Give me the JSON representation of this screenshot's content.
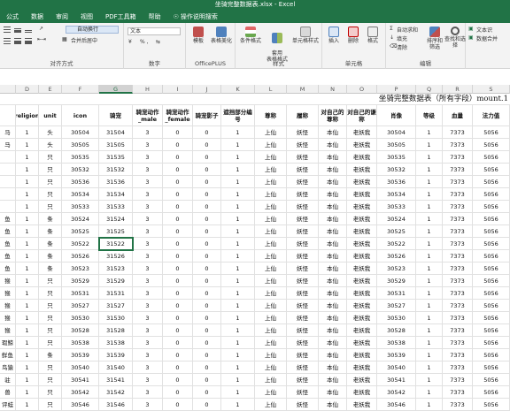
{
  "window_title": "坐骑完整数据表.xlsx  -  Excel",
  "tabs": [
    "公式",
    "数据",
    "审阅",
    "视图",
    "PDF工具箱",
    "帮助",
    "操作说明搜索"
  ],
  "ribbon": {
    "wrap_text": "自动换行",
    "merge_center": "合并后居中",
    "alignment_group": "对齐方式",
    "number_format": "文本",
    "number_group": "数字",
    "number_symbols": "% ,",
    "template": "模板",
    "table_beautify": "表格美化",
    "officeplus_group": "OfficePLUS",
    "conditional_format": "条件格式",
    "format_as_table": "套用\n表格格式",
    "cell_style": "单元格样式",
    "styles_group": "样式",
    "insert": "插入",
    "delete": "删除",
    "format": "格式",
    "cells_group": "单元格",
    "autosum": "自动求和",
    "fill": "填充",
    "clear": "清除",
    "sort_filter": "排序和筛选",
    "find_select": "查找和选择",
    "editing_group": "编辑",
    "text_recognize": "文本识",
    "data_consolidate": "数据合并"
  },
  "columns": [
    "D",
    "E",
    "F",
    "G",
    "H",
    "I",
    "J",
    "K",
    "L",
    "M",
    "N",
    "O",
    "P",
    "Q",
    "R",
    "S"
  ],
  "selected_column": "G",
  "banner": "坐骑完整数据表（所有字段）mount.1",
  "header_row": [
    "religion",
    "unit",
    "icon",
    "骑宠",
    "骑宠动作_male",
    "骑宠动作_female",
    "骑宠影子",
    "遮挡部分编号",
    "尊称",
    "履称",
    "对自己的尊称",
    "对自己的谦称",
    "肖像",
    "等级",
    "血量",
    "法力值"
  ],
  "first_col_header": "",
  "rows": [
    [
      "马",
      "1",
      "头",
      "30504",
      "31504",
      "3",
      "0",
      "0",
      "1",
      "上仙",
      "妖怪",
      "本仙",
      "老妖我",
      "30504",
      "1",
      "7373",
      "5056"
    ],
    [
      "马",
      "1",
      "头",
      "30505",
      "31505",
      "3",
      "0",
      "0",
      "1",
      "上仙",
      "妖怪",
      "本仙",
      "老妖我",
      "30505",
      "1",
      "7373",
      "5056"
    ],
    [
      "",
      "1",
      "只",
      "30535",
      "31535",
      "3",
      "0",
      "0",
      "1",
      "上仙",
      "妖怪",
      "本仙",
      "老妖我",
      "30535",
      "1",
      "7373",
      "5056"
    ],
    [
      "",
      "1",
      "只",
      "30532",
      "31532",
      "3",
      "0",
      "0",
      "1",
      "上仙",
      "妖怪",
      "本仙",
      "老妖我",
      "30532",
      "1",
      "7373",
      "5056"
    ],
    [
      "",
      "1",
      "只",
      "30536",
      "31536",
      "3",
      "0",
      "0",
      "1",
      "上仙",
      "妖怪",
      "本仙",
      "老妖我",
      "30536",
      "1",
      "7373",
      "5056"
    ],
    [
      "",
      "1",
      "只",
      "30534",
      "31534",
      "3",
      "0",
      "0",
      "1",
      "上仙",
      "妖怪",
      "本仙",
      "老妖我",
      "30534",
      "1",
      "7373",
      "5056"
    ],
    [
      "",
      "1",
      "只",
      "30533",
      "31533",
      "3",
      "0",
      "0",
      "1",
      "上仙",
      "妖怪",
      "本仙",
      "老妖我",
      "30533",
      "1",
      "7373",
      "5056"
    ],
    [
      "鱼",
      "1",
      "条",
      "30524",
      "31524",
      "3",
      "0",
      "0",
      "1",
      "上仙",
      "妖怪",
      "本仙",
      "老妖我",
      "30524",
      "1",
      "7373",
      "5056"
    ],
    [
      "鱼",
      "1",
      "条",
      "30525",
      "31525",
      "3",
      "0",
      "0",
      "1",
      "上仙",
      "妖怪",
      "本仙",
      "老妖我",
      "30525",
      "1",
      "7373",
      "5056"
    ],
    [
      "鱼",
      "1",
      "条",
      "30522",
      "31522",
      "3",
      "0",
      "0",
      "1",
      "上仙",
      "妖怪",
      "本仙",
      "老妖我",
      "30522",
      "1",
      "7373",
      "5056"
    ],
    [
      "鱼",
      "1",
      "条",
      "30526",
      "31526",
      "3",
      "0",
      "0",
      "1",
      "上仙",
      "妖怪",
      "本仙",
      "老妖我",
      "30526",
      "1",
      "7373",
      "5056"
    ],
    [
      "鱼",
      "1",
      "条",
      "30523",
      "31523",
      "3",
      "0",
      "0",
      "1",
      "上仙",
      "妖怪",
      "本仙",
      "老妖我",
      "30523",
      "1",
      "7373",
      "5056"
    ],
    [
      "猴",
      "1",
      "只",
      "30529",
      "31529",
      "3",
      "0",
      "0",
      "1",
      "上仙",
      "妖怪",
      "本仙",
      "老妖我",
      "30529",
      "1",
      "7373",
      "5056"
    ],
    [
      "猴",
      "1",
      "只",
      "30531",
      "31531",
      "3",
      "0",
      "0",
      "1",
      "上仙",
      "妖怪",
      "本仙",
      "老妖我",
      "30531",
      "1",
      "7373",
      "5056"
    ],
    [
      "猴",
      "1",
      "只",
      "30527",
      "31527",
      "3",
      "0",
      "0",
      "1",
      "上仙",
      "妖怪",
      "本仙",
      "老妖我",
      "30527",
      "1",
      "7373",
      "5056"
    ],
    [
      "猴",
      "1",
      "只",
      "30530",
      "31530",
      "3",
      "0",
      "0",
      "1",
      "上仙",
      "妖怪",
      "本仙",
      "老妖我",
      "30530",
      "1",
      "7373",
      "5056"
    ],
    [
      "猴",
      "1",
      "只",
      "30528",
      "31528",
      "3",
      "0",
      "0",
      "1",
      "上仙",
      "妖怪",
      "本仙",
      "老妖我",
      "30528",
      "1",
      "7373",
      "5056"
    ],
    [
      "瑕鲸",
      "1",
      "只",
      "30538",
      "31538",
      "3",
      "0",
      "0",
      "1",
      "上仙",
      "妖怪",
      "本仙",
      "老妖我",
      "30538",
      "1",
      "7373",
      "5056"
    ],
    [
      "鲜鱼",
      "1",
      "条",
      "30539",
      "31539",
      "3",
      "0",
      "0",
      "1",
      "上仙",
      "妖怪",
      "本仙",
      "老妖我",
      "30539",
      "1",
      "7373",
      "5056"
    ],
    [
      "鸟猿",
      "1",
      "只",
      "30540",
      "31540",
      "3",
      "0",
      "0",
      "1",
      "上仙",
      "妖怪",
      "本仙",
      "老妖我",
      "30540",
      "1",
      "7373",
      "5056"
    ],
    [
      "驻",
      "1",
      "只",
      "30541",
      "31541",
      "3",
      "0",
      "0",
      "1",
      "上仙",
      "妖怪",
      "本仙",
      "老妖我",
      "30541",
      "1",
      "7373",
      "5056"
    ],
    [
      "兽",
      "1",
      "只",
      "30542",
      "31542",
      "3",
      "0",
      "0",
      "1",
      "上仙",
      "妖怪",
      "本仙",
      "老妖我",
      "30542",
      "1",
      "7373",
      "5056"
    ],
    [
      "评蛙",
      "1",
      "只",
      "30546",
      "31546",
      "3",
      "0",
      "0",
      "1",
      "上仙",
      "妖怪",
      "本仙",
      "老妖我",
      "30546",
      "1",
      "7373",
      "5056"
    ]
  ],
  "active_cell_value": "31522",
  "colors": {
    "brand": "#217346",
    "ribbon_bg": "#f3f3f3",
    "grid_line": "#e1e1e1"
  }
}
